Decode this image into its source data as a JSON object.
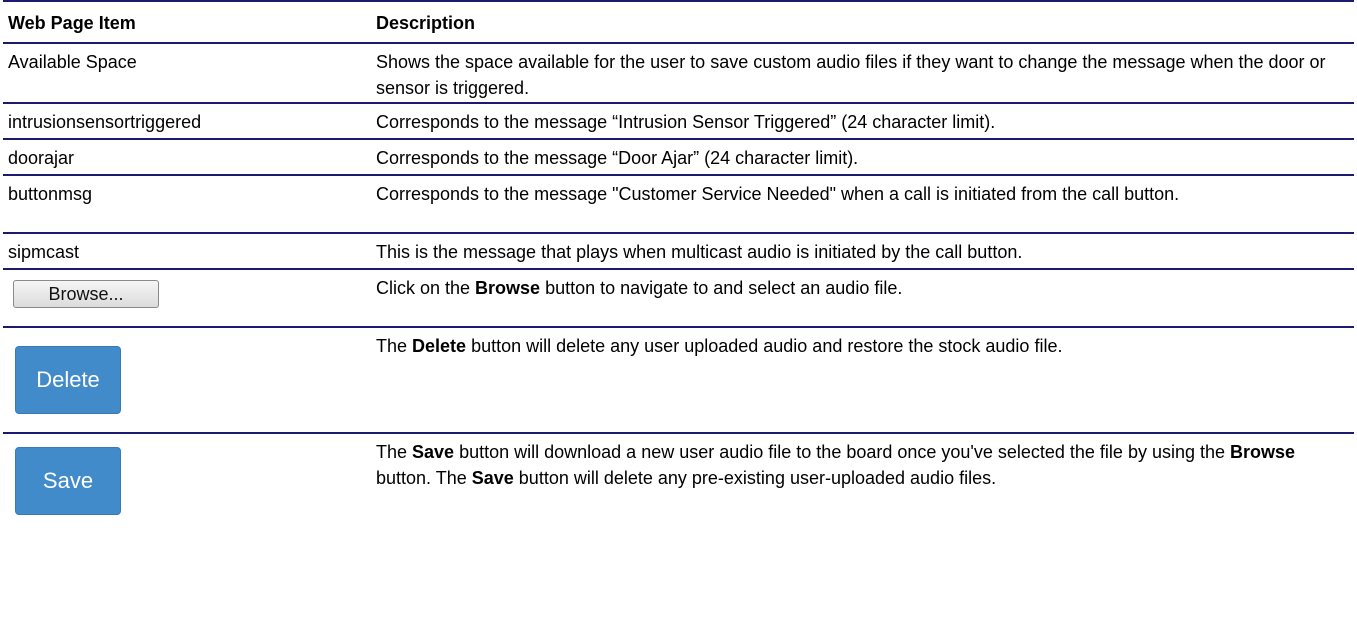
{
  "table": {
    "headers": {
      "item": "Web Page Item",
      "description": "Description"
    },
    "rows": [
      {
        "item": "Available Space",
        "description": "Shows the space available for the user to save custom audio files if they want to change the message when the door or sensor is triggered."
      },
      {
        "item": "intrusionsensortriggered",
        "description": "Corresponds to the message “Intrusion Sensor Triggered” (24 character limit)."
      },
      {
        "item": "doorajar",
        "description": "Corresponds to the message “Door Ajar” (24 character limit)."
      },
      {
        "item": "buttonmsg",
        "description": "Corresponds to the message \"Customer Service Needed\" when a call is initiated from the call button."
      },
      {
        "item": "sipmcast",
        "description": "This is the message that plays when multicast audio is initiated by the call button."
      }
    ],
    "browse": {
      "button_label": "Browse...",
      "desc_pre": "Click on the ",
      "desc_bold": "Browse",
      "desc_post": " button to navigate to and select an audio file."
    },
    "delete": {
      "button_label": "Delete",
      "desc_pre": "The ",
      "desc_bold": "Delete",
      "desc_post": " button will delete any user uploaded audio and restore the stock audio file."
    },
    "save": {
      "button_label": "Save",
      "desc_pre": "The ",
      "desc_bold1": "Save",
      "desc_mid1": " button will download a new user audio file to the board once you've selected the file by using the ",
      "desc_bold2": "Browse",
      "desc_mid2": " button. The ",
      "desc_bold3": "Save",
      "desc_post": " button will delete any pre-existing user-uploaded audio files."
    }
  },
  "colors": {
    "rule": "#1a1a6e",
    "button_blue": "#428bca",
    "button_text": "#ffffff"
  }
}
